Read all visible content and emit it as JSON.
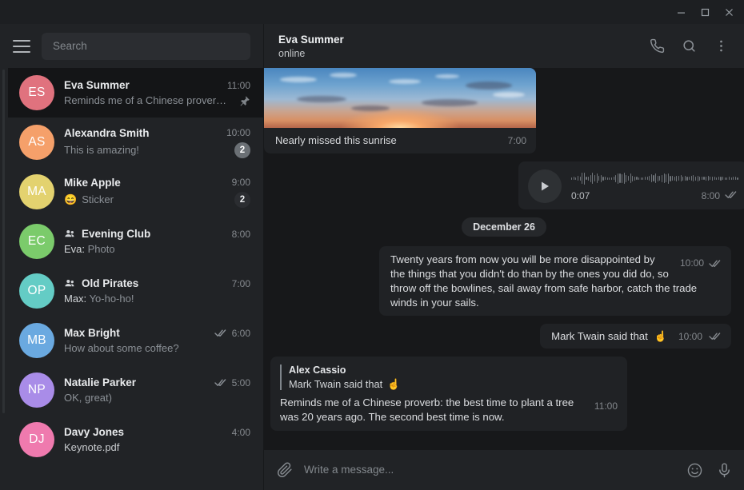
{
  "window": {
    "controls": [
      {
        "name": "minimize",
        "glyph": "minimize-icon"
      },
      {
        "name": "maximize",
        "glyph": "maximize-icon"
      },
      {
        "name": "close",
        "glyph": "close-icon"
      }
    ]
  },
  "sidebar": {
    "menu_icon": "hamburger-menu-icon",
    "search": {
      "value": "",
      "placeholder": "Search"
    },
    "chats": [
      {
        "initials": "ES",
        "color": "#e0727e",
        "name": "Eva Summer",
        "time": "11:00",
        "preview": "Reminds me of a Chinese prover…",
        "active": true,
        "pinned": true,
        "group": false,
        "badge": null,
        "checks": false,
        "sender": "",
        "emoji": ""
      },
      {
        "initials": "AS",
        "color": "#f5a06a",
        "name": "Alexandra Smith",
        "time": "10:00",
        "preview": "This is amazing!",
        "active": false,
        "pinned": false,
        "group": false,
        "badge": "2",
        "badge_style": "muted",
        "checks": false,
        "sender": "",
        "emoji": ""
      },
      {
        "initials": "MA",
        "color": "#e3d26f",
        "name": "Mike Apple",
        "time": "9:00",
        "preview": "Sticker",
        "active": false,
        "pinned": false,
        "group": false,
        "badge": "2",
        "badge_style": "dark",
        "checks": false,
        "sender": "",
        "emoji": "😄"
      },
      {
        "initials": "EC",
        "color": "#7bcb6b",
        "name": "Evening Club",
        "time": "8:00",
        "preview": "Photo",
        "active": false,
        "pinned": false,
        "group": true,
        "badge": null,
        "checks": false,
        "sender": "Eva:",
        "emoji": ""
      },
      {
        "initials": "OP",
        "color": "#64ccc5",
        "name": "Old Pirates",
        "time": "7:00",
        "preview": "Yo-ho-ho!",
        "active": false,
        "pinned": false,
        "group": true,
        "badge": null,
        "checks": false,
        "sender": "Max:",
        "emoji": ""
      },
      {
        "initials": "MB",
        "color": "#6aa9e0",
        "name": "Max Bright",
        "time": "6:00",
        "preview": "How about some coffee?",
        "active": false,
        "pinned": false,
        "group": false,
        "badge": null,
        "checks": true,
        "sender": "",
        "emoji": ""
      },
      {
        "initials": "NP",
        "color": "#a98ce8",
        "name": "Natalie Parker",
        "time": "5:00",
        "preview": "OK, great)",
        "active": false,
        "pinned": false,
        "group": false,
        "badge": null,
        "checks": true,
        "sender": "",
        "emoji": ""
      },
      {
        "initials": "DJ",
        "color": "#ef7aae",
        "name": "Davy Jones",
        "time": "4:00",
        "preview": "Keynote.pdf",
        "active": false,
        "preview_bright": true,
        "pinned": false,
        "group": false,
        "badge": null,
        "checks": false,
        "sender": "",
        "emoji": ""
      }
    ]
  },
  "chat": {
    "title": "Eva Summer",
    "status": "online",
    "actions": [
      {
        "name": "call-icon",
        "label": "Call"
      },
      {
        "name": "search-icon",
        "label": "Search"
      },
      {
        "name": "more-menu-icon",
        "label": "More"
      }
    ],
    "messages": {
      "photo": {
        "caption": "Nearly missed this sunrise",
        "time": "7:00"
      },
      "voice": {
        "duration": "0:07",
        "time": "8:00",
        "play_icon": "play-icon"
      },
      "date_separator": "December 26",
      "quote_message": {
        "text": "Twenty years from now you will be more disappointed by the things that you didn't do than by the ones you did do, so throw off the bowlines, sail away from safe harbor, catch the trade winds in your sails.",
        "time": "10:00"
      },
      "short_message": {
        "text": "Mark Twain said that",
        "emoji": "☝️",
        "time": "10:00"
      },
      "reply_message": {
        "quote_name": "Alex Cassio",
        "quote_text": "Mark Twain said that",
        "quote_emoji": "☝️",
        "text": "Reminds me of a Chinese proverb: the best time to plant a tree was 20 years ago. The second best time is now.",
        "time": "11:00"
      }
    },
    "composer": {
      "attach_icon": "paperclip-icon",
      "input": {
        "value": "",
        "placeholder": "Write a message..."
      },
      "emoji_icon": "smiley-icon",
      "mic_icon": "microphone-icon"
    }
  }
}
